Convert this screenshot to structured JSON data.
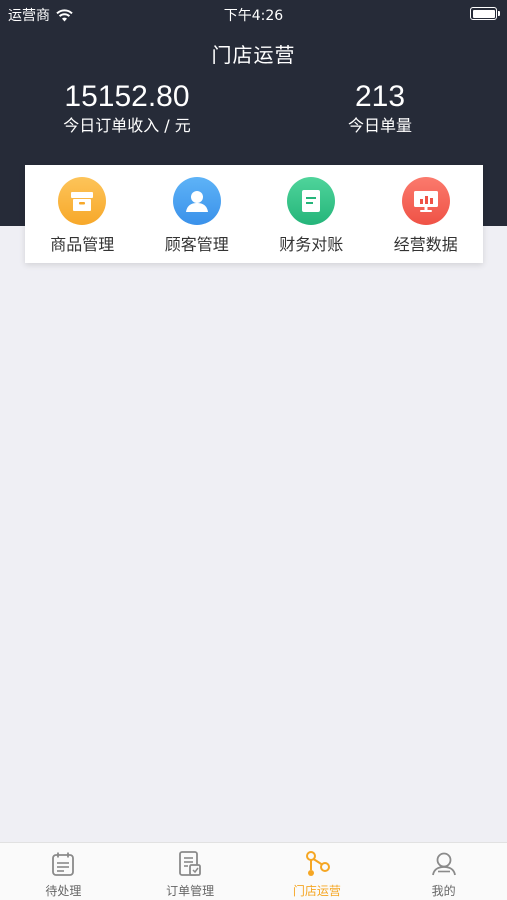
{
  "status_bar": {
    "carrier": "运营商",
    "time": "下午4:26"
  },
  "header": {
    "title": "门店运营"
  },
  "stats": {
    "income": {
      "value": "15152.80",
      "label": "今日订单收入 / 元"
    },
    "orders": {
      "value": "213",
      "label": "今日单量"
    }
  },
  "quick_actions": [
    {
      "label": "商品管理",
      "icon": "box-icon",
      "color": "#f7a82a"
    },
    {
      "label": "顾客管理",
      "icon": "user-icon",
      "color": "#3a91ea"
    },
    {
      "label": "财务对账",
      "icon": "document-icon",
      "color": "#25b57a"
    },
    {
      "label": "经营数据",
      "icon": "chart-screen-icon",
      "color": "#ef5246"
    }
  ],
  "tab_bar": {
    "items": [
      {
        "label": "待处理",
        "icon": "calendar-icon",
        "active": false
      },
      {
        "label": "订单管理",
        "icon": "order-list-icon",
        "active": false
      },
      {
        "label": "门店运营",
        "icon": "nodes-icon",
        "active": true
      },
      {
        "label": "我的",
        "icon": "profile-icon",
        "active": false
      }
    ],
    "active_color": "#f5a623"
  }
}
